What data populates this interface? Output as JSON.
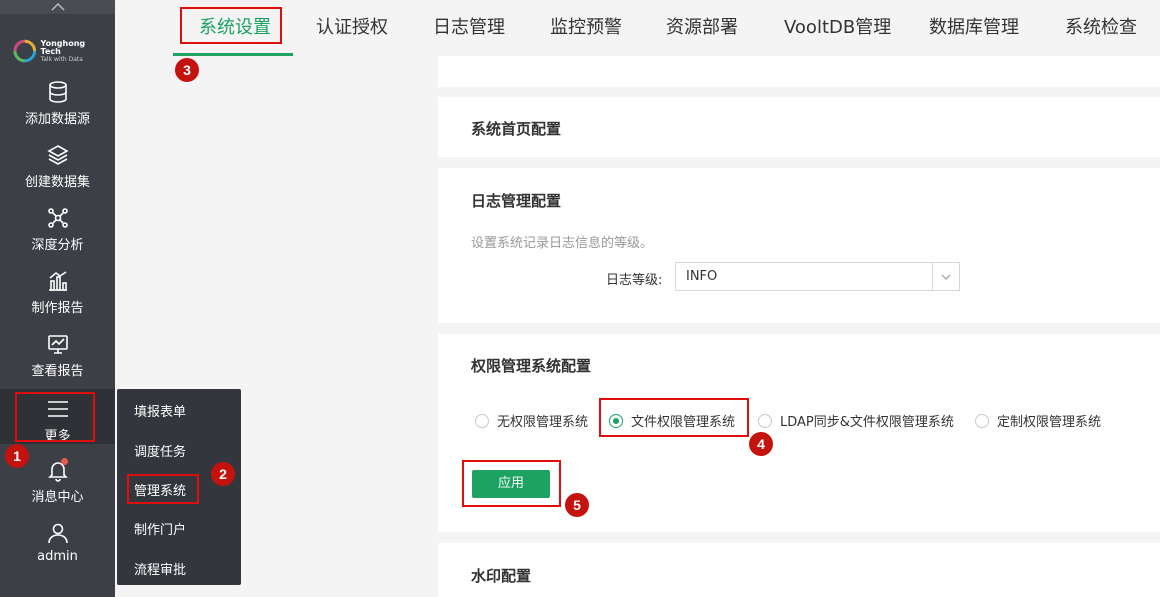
{
  "leftnav": {
    "logo": {
      "title": "Yonghong Tech",
      "subtitle": "Talk with Data"
    },
    "items": [
      {
        "label": "添加数据源",
        "icon": "database-icon"
      },
      {
        "label": "创建数据集",
        "icon": "layers-icon"
      },
      {
        "label": "深度分析",
        "icon": "network-icon"
      },
      {
        "label": "制作报告",
        "icon": "chart-icon"
      },
      {
        "label": "查看报告",
        "icon": "monitor-icon"
      },
      {
        "label": "更多",
        "icon": "menu-icon"
      },
      {
        "label": "消息中心",
        "icon": "bell-icon"
      },
      {
        "label": "admin",
        "icon": "user-icon"
      }
    ]
  },
  "more_menu": {
    "items": [
      "填报表单",
      "调度任务",
      "管理系统",
      "制作门户",
      "流程审批"
    ]
  },
  "tabs": [
    "系统设置",
    "认证授权",
    "日志管理",
    "监控预警",
    "资源部署",
    "VooltDB管理",
    "数据库管理",
    "系统检查"
  ],
  "cards": {
    "homepage_title": "系统首页配置",
    "log_title": "日志管理配置",
    "log_desc": "设置系统记录日志信息的等级。",
    "log_level_label": "日志等级:",
    "log_level_value": "INFO",
    "perm_title": "权限管理系统配置",
    "perm_options": [
      "无权限管理系统",
      "文件权限管理系统",
      "LDAP同步&文件权限管理系统",
      "定制权限管理系统"
    ],
    "perm_selected": "文件权限管理系统",
    "apply_label": "应用",
    "watermark_title": "水印配置"
  },
  "annotations": [
    "1",
    "2",
    "3",
    "4",
    "5"
  ],
  "colors": {
    "accent": "#1ca261",
    "nav_bg": "#3d3f46",
    "annotation": "#e00d0d"
  }
}
